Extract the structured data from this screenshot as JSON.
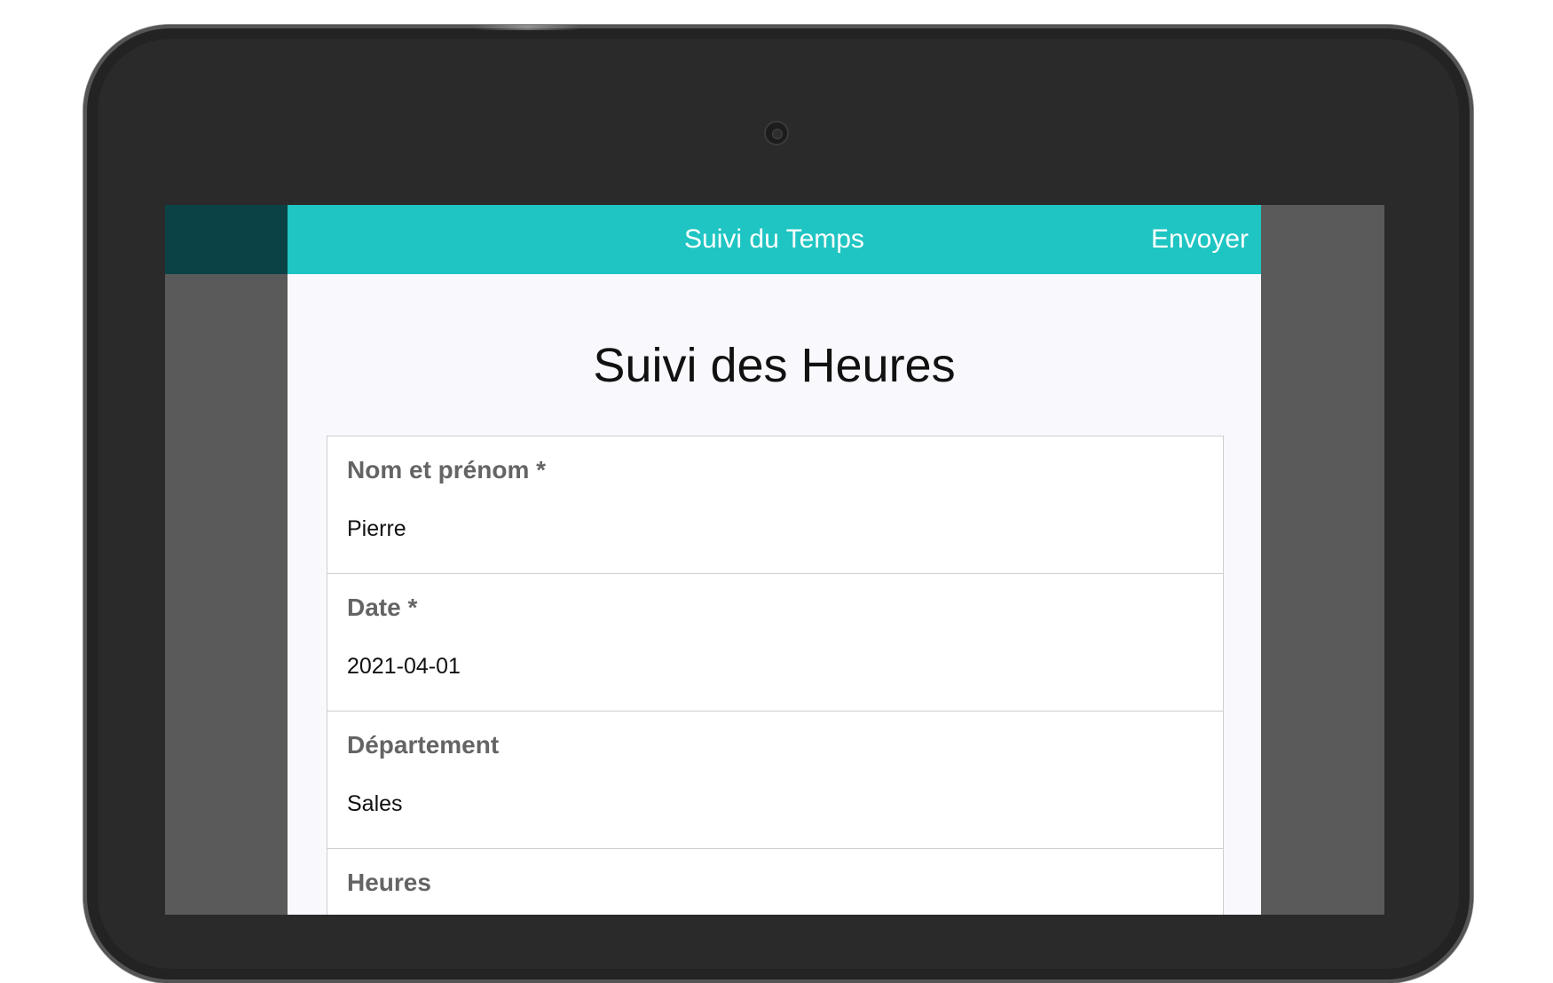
{
  "app": {
    "header_title": "Suivi du Temps",
    "send_label": "Envoyer"
  },
  "form": {
    "title": "Suivi des Heures",
    "fields": [
      {
        "label": "Nom et prénom *",
        "value": "Pierre"
      },
      {
        "label": "Date *",
        "value": "2021-04-01"
      },
      {
        "label": "Département",
        "value": "Sales"
      },
      {
        "label": "Heures",
        "value": ""
      }
    ]
  },
  "colors": {
    "header": "#1fc5c3",
    "header_dark": "#0b4245",
    "device_frame": "#2a2a2a",
    "screen_side": "#5a5a5a",
    "app_background": "#f9f9fd"
  }
}
